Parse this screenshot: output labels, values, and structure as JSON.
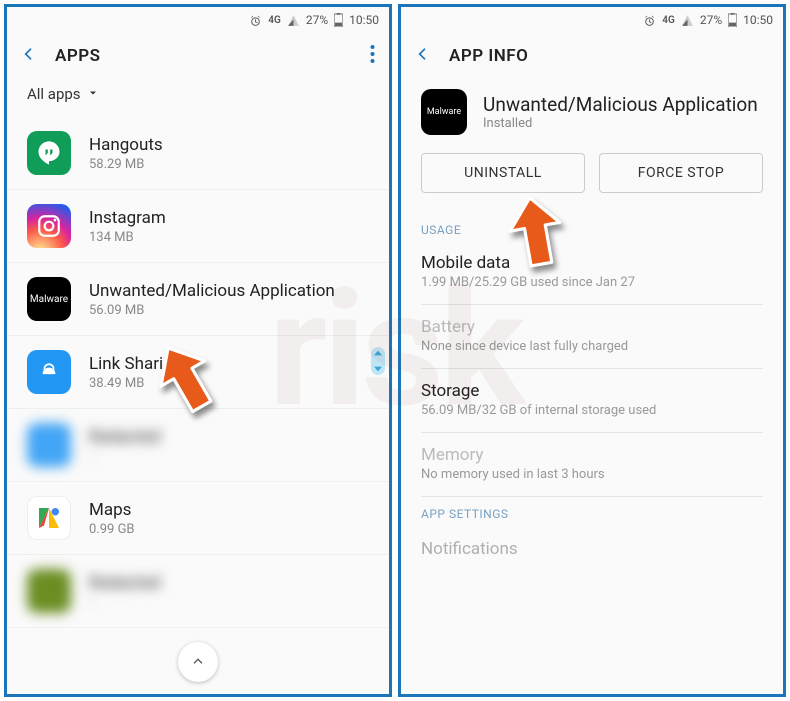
{
  "status": {
    "network": "4G",
    "battery_pct": "27%",
    "time": "10:50"
  },
  "left": {
    "title": "APPS",
    "filter_label": "All apps",
    "apps": [
      {
        "name": "Hangouts",
        "size": "58.29 MB",
        "icon": "hangouts"
      },
      {
        "name": "Instagram",
        "size": "134 MB",
        "icon": "instagram"
      },
      {
        "name": "Unwanted/Malicious Application",
        "size": "56.09 MB",
        "icon": "malware",
        "icon_label": "Malware"
      },
      {
        "name": "Link Sharing",
        "size": "38.49 MB",
        "icon": "link-sharing"
      },
      {
        "name": "",
        "size": "",
        "icon": "unknown",
        "blurred": true
      },
      {
        "name": "Maps",
        "size": "0.99 GB",
        "icon": "maps"
      },
      {
        "name": "",
        "size": "",
        "icon": "unknown",
        "blurred": true
      }
    ]
  },
  "right": {
    "title": "APP INFO",
    "app_name": "Unwanted/Malicious Application",
    "app_status": "Installed",
    "app_icon_label": "Malware",
    "buttons": {
      "uninstall": "UNINSTALL",
      "force_stop": "FORCE STOP"
    },
    "usage_label": "USAGE",
    "mobile_data": {
      "k": "Mobile data",
      "v": "1.99 MB/25.29 GB used since Jan 27"
    },
    "battery": {
      "k": "Battery",
      "v": "None since device last fully charged"
    },
    "storage": {
      "k": "Storage",
      "v": "56.09 MB/32 GB of internal storage used"
    },
    "memory": {
      "k": "Memory",
      "v": "No memory used in last 3 hours"
    },
    "app_settings_label": "APP SETTINGS",
    "notifications_cutoff": "Notifications"
  },
  "colors": {
    "frame_border": "#1b75bb",
    "arrow_fill": "#e85a1a",
    "arrow_stroke": "#ffffff"
  }
}
